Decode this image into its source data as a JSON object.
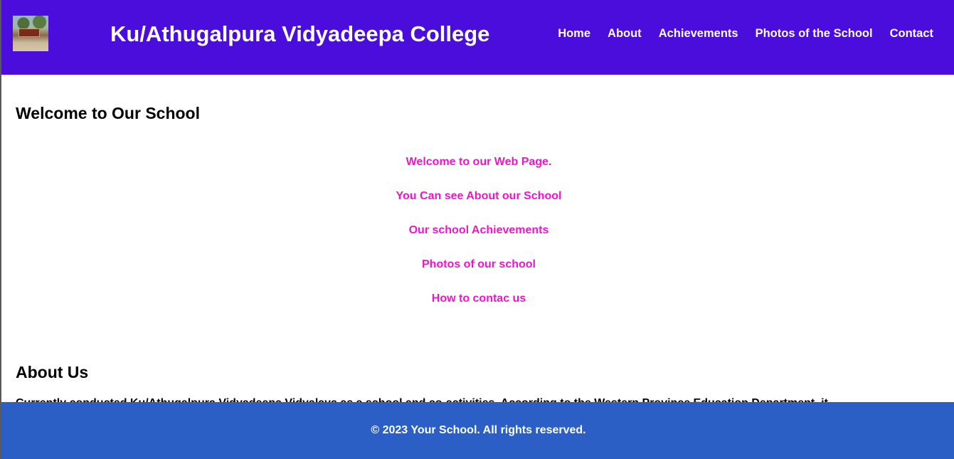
{
  "header": {
    "logo_icon": "school-building-photo",
    "title": "Ku/Athugalpura Vidyadeepa College",
    "nav": [
      "Home",
      "About",
      "Achievements",
      "Photos of the School",
      "Contact"
    ]
  },
  "welcome": {
    "heading": "Welcome to Our School",
    "links": [
      "Welcome to our Web Page.",
      "You Can see About our School",
      "Our school Achievements",
      "Photos of our school",
      "How to contac us"
    ]
  },
  "about": {
    "heading": "About Us",
    "text": "Currently conducted Ku/Athugalpura Vidyadeepa Vidyalaya as a school and co-activities. According to the Western Province Education Department, it"
  },
  "footer": {
    "copyright": "© 2023 Your School. All rights reserved."
  },
  "colors": {
    "header_bg": "#4a0ddc",
    "link_color": "#ef16c9",
    "footer_bg": "#2b5fc6"
  }
}
